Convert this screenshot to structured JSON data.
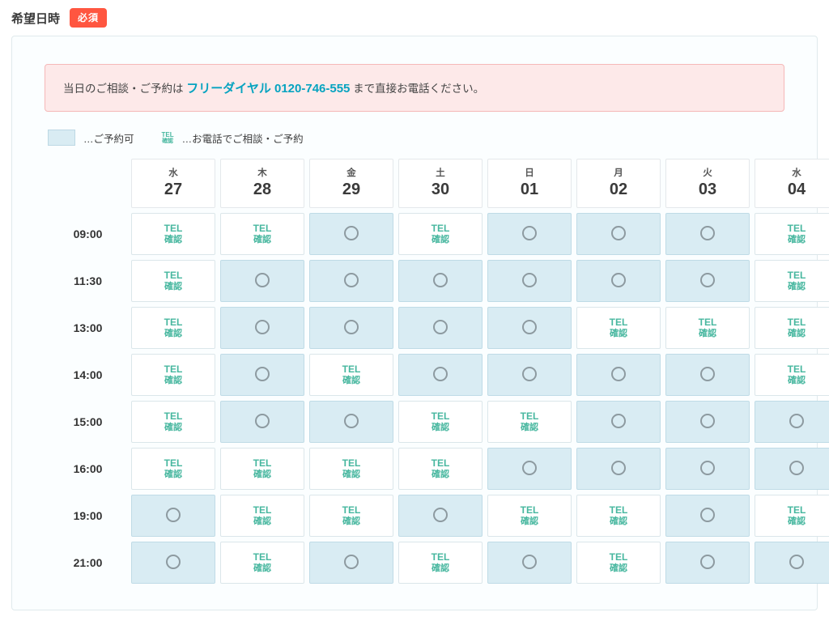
{
  "heading": "希望日時",
  "required_badge": "必須",
  "notice": {
    "pre": "当日のご相談・ご予約は",
    "tel": "フリーダイヤル 0120-746-555",
    "post": "まで直接お電話ください。"
  },
  "legend": {
    "available": "…ご予約可",
    "tel": "…お電話でご相談・ご予約"
  },
  "tel_label": {
    "line1": "TEL",
    "line2": "確認"
  },
  "days": [
    {
      "dow": "水",
      "dom": "27"
    },
    {
      "dow": "木",
      "dom": "28"
    },
    {
      "dow": "金",
      "dom": "29"
    },
    {
      "dow": "土",
      "dom": "30"
    },
    {
      "dow": "日",
      "dom": "01"
    },
    {
      "dow": "月",
      "dom": "02"
    },
    {
      "dow": "火",
      "dom": "03"
    },
    {
      "dow": "水",
      "dom": "04"
    }
  ],
  "times": [
    "09:00",
    "11:30",
    "13:00",
    "14:00",
    "15:00",
    "16:00",
    "19:00",
    "21:00"
  ],
  "slots": [
    [
      "tel",
      "tel",
      "avail",
      "tel",
      "avail",
      "avail",
      "avail",
      "tel"
    ],
    [
      "tel",
      "avail",
      "avail",
      "avail",
      "avail",
      "avail",
      "avail",
      "tel"
    ],
    [
      "tel",
      "avail",
      "avail",
      "avail",
      "avail",
      "tel",
      "tel",
      "tel"
    ],
    [
      "tel",
      "avail",
      "tel",
      "avail",
      "avail",
      "avail",
      "avail",
      "tel"
    ],
    [
      "tel",
      "avail",
      "avail",
      "tel",
      "tel",
      "avail",
      "avail",
      "avail"
    ],
    [
      "tel",
      "tel",
      "tel",
      "tel",
      "avail",
      "avail",
      "avail",
      "avail"
    ],
    [
      "avail",
      "tel",
      "tel",
      "avail",
      "tel",
      "tel",
      "avail",
      "tel"
    ],
    [
      "avail",
      "tel",
      "avail",
      "tel",
      "avail",
      "tel",
      "avail",
      "avail"
    ]
  ]
}
